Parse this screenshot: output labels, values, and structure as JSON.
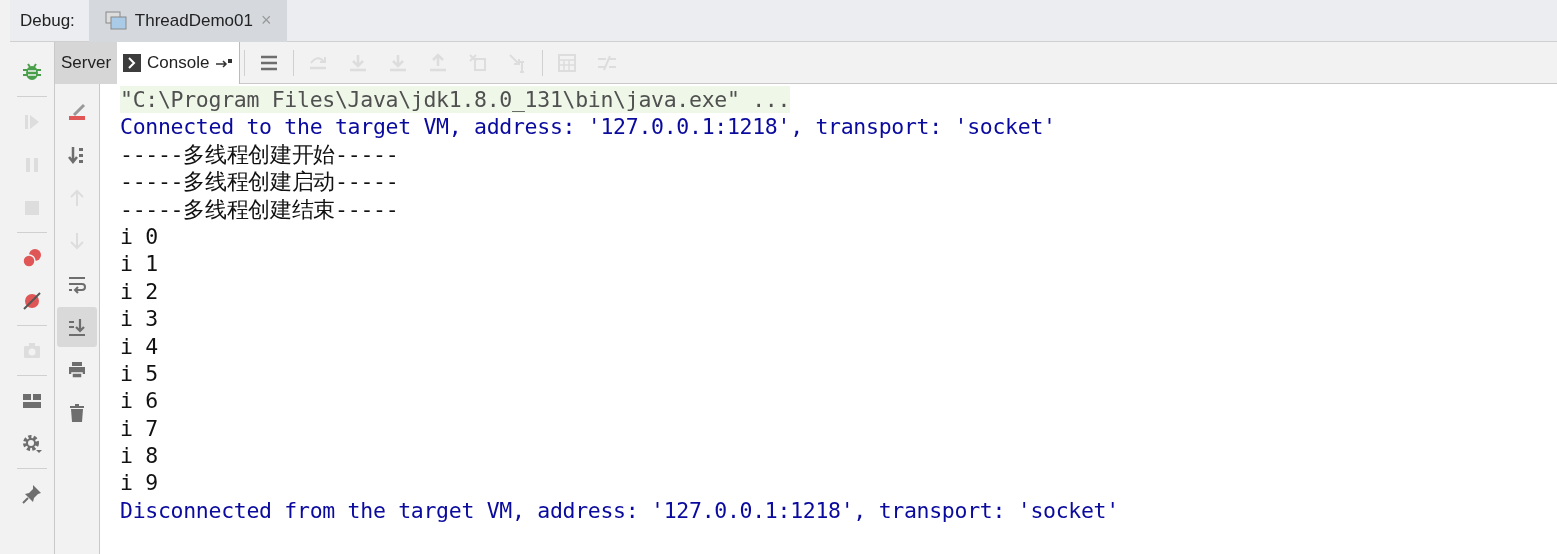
{
  "header": {
    "label": "Debug:",
    "tabs": [
      {
        "title": "ThreadDemo01",
        "close": "×",
        "selected": true
      }
    ]
  },
  "console_tabs": [
    {
      "label": "Server",
      "selected": false
    },
    {
      "label": "Console",
      "selected": true
    }
  ],
  "top_toolbar": [
    {
      "kind": "frames",
      "disabled": false
    },
    {
      "kind": "step-over",
      "disabled": true
    },
    {
      "kind": "step-into",
      "disabled": true
    },
    {
      "kind": "force-step-into",
      "disabled": true
    },
    {
      "kind": "step-out",
      "disabled": true
    },
    {
      "kind": "drop-frame",
      "disabled": true
    },
    {
      "kind": "run-to-cursor",
      "disabled": true
    },
    {
      "kind": "evaluate",
      "disabled": true
    },
    {
      "kind": "trace",
      "disabled": true
    }
  ],
  "debug_toolbar": [
    {
      "kind": "rerun",
      "disabled": false
    },
    {
      "kind": "resume",
      "disabled": true
    },
    {
      "kind": "pause",
      "disabled": true
    },
    {
      "kind": "stop",
      "disabled": true
    },
    {
      "kind": "breakpoints",
      "disabled": false
    },
    {
      "kind": "mute",
      "disabled": false
    },
    {
      "kind": "snapshot",
      "disabled": true
    },
    {
      "kind": "layout",
      "disabled": false
    },
    {
      "kind": "settings",
      "disabled": false
    },
    {
      "kind": "pin",
      "disabled": false
    }
  ],
  "console_toolbar": [
    {
      "kind": "clear-edit",
      "disabled": false,
      "on": false
    },
    {
      "kind": "sort",
      "disabled": false,
      "on": false
    },
    {
      "kind": "up",
      "disabled": true,
      "on": false
    },
    {
      "kind": "down",
      "disabled": true,
      "on": false
    },
    {
      "kind": "wrap",
      "disabled": false,
      "on": false
    },
    {
      "kind": "scroll-end",
      "disabled": false,
      "on": true
    },
    {
      "kind": "print",
      "disabled": false,
      "on": false
    },
    {
      "kind": "trash",
      "disabled": false,
      "on": false
    }
  ],
  "console_lines": [
    {
      "kind": "command",
      "text": "\"C:\\Program Files\\Java\\jdk1.8.0_131\\bin\\java.exe\" ..."
    },
    {
      "kind": "system",
      "text": "Connected to the target VM, address: '127.0.0.1:1218', transport: 'socket'"
    },
    {
      "kind": "output",
      "text": "-----多线程创建开始-----"
    },
    {
      "kind": "output",
      "text": "-----多线程创建启动-----"
    },
    {
      "kind": "output",
      "text": "-----多线程创建结束-----"
    },
    {
      "kind": "output",
      "text": "i 0"
    },
    {
      "kind": "output",
      "text": "i 1"
    },
    {
      "kind": "output",
      "text": "i 2"
    },
    {
      "kind": "output",
      "text": "i 3"
    },
    {
      "kind": "output",
      "text": "i 4"
    },
    {
      "kind": "output",
      "text": "i 5"
    },
    {
      "kind": "output",
      "text": "i 6"
    },
    {
      "kind": "output",
      "text": "i 7"
    },
    {
      "kind": "output",
      "text": "i 8"
    },
    {
      "kind": "output",
      "text": "i 9"
    },
    {
      "kind": "system",
      "text": "Disconnected from the target VM, address: '127.0.0.1:1218', transport: 'socket'"
    }
  ]
}
